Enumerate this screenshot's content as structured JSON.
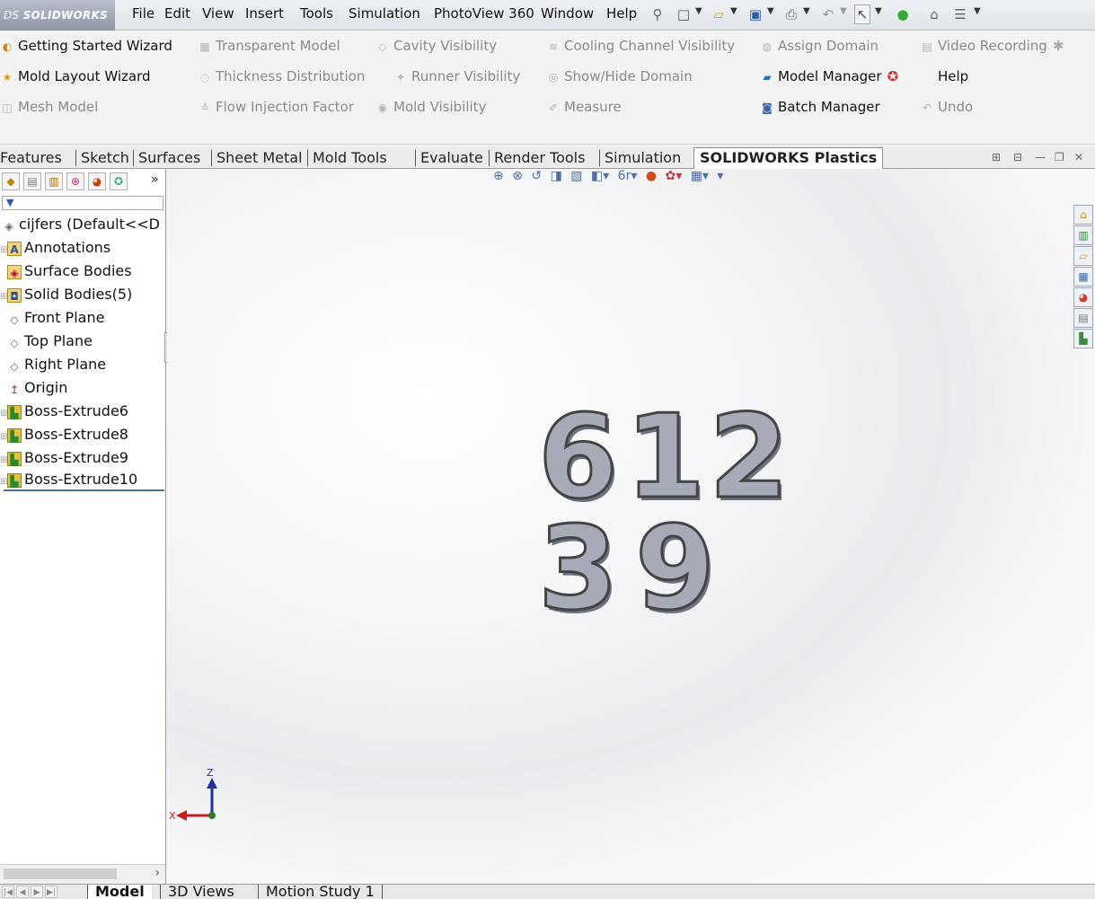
{
  "app": {
    "logo_prefix": "DS ",
    "logo_brand": "SOLIDWORKS"
  },
  "menu": {
    "items": [
      "File",
      "Edit",
      "View",
      "Insert",
      "Tools",
      "Simulation",
      "PhotoView 360",
      "Window",
      "Help"
    ]
  },
  "command_manager": {
    "row1": [
      {
        "label": "Getting Started Wizard",
        "enabled": true
      },
      {
        "label": "Transparent Model",
        "enabled": false
      },
      {
        "label": "Cavity Visibility",
        "enabled": false
      },
      {
        "label": "Cooling Channel Visibility",
        "enabled": false
      },
      {
        "label": "Assign Domain",
        "enabled": false
      },
      {
        "label": "Video Recording",
        "enabled": false
      }
    ],
    "row2": [
      {
        "label": "Mold Layout Wizard",
        "enabled": true
      },
      {
        "label": "Thickness Distribution",
        "enabled": false
      },
      {
        "label": "Runner Visibility",
        "enabled": false
      },
      {
        "label": "Show/Hide Domain",
        "enabled": false
      },
      {
        "label": "Model Manager",
        "enabled": true
      },
      {
        "label": "Help",
        "enabled": true
      }
    ],
    "row3": [
      {
        "label": "Mesh Model",
        "enabled": false
      },
      {
        "label": "Flow Injection Factor",
        "enabled": false
      },
      {
        "label": "Mold Visibility",
        "enabled": false
      },
      {
        "label": "Measure",
        "enabled": false
      },
      {
        "label": "Batch Manager",
        "enabled": true
      },
      {
        "label": "Undo",
        "enabled": false
      }
    ]
  },
  "tabs": [
    {
      "label": "Features"
    },
    {
      "label": "Sketch"
    },
    {
      "label": "Surfaces"
    },
    {
      "label": "Sheet Metal"
    },
    {
      "label": "Mold Tools"
    },
    {
      "label": "Evaluate"
    },
    {
      "label": "Render Tools"
    },
    {
      "label": "Simulation"
    },
    {
      "label": "SOLIDWORKS Plastics",
      "active": true
    }
  ],
  "feature_tree": {
    "part_name": "cijfers  (Default<<D",
    "items": [
      {
        "label": "Annotations",
        "icon": "annotations-icon"
      },
      {
        "label": "Surface Bodies",
        "icon": "surface-bodies-icon"
      },
      {
        "label": "Solid Bodies(5)",
        "icon": "solid-bodies-icon"
      },
      {
        "label": "Front Plane",
        "icon": "plane-icon"
      },
      {
        "label": "Top Plane",
        "icon": "plane-icon"
      },
      {
        "label": "Right Plane",
        "icon": "plane-icon"
      },
      {
        "label": "Origin",
        "icon": "origin-icon"
      },
      {
        "label": "Boss-Extrude6",
        "icon": "extrude-icon"
      },
      {
        "label": "Boss-Extrude8",
        "icon": "extrude-icon"
      },
      {
        "label": "Boss-Extrude9",
        "icon": "extrude-icon"
      },
      {
        "label": "Boss-Extrude10",
        "icon": "extrude-icon"
      }
    ],
    "more_glyph": "»"
  },
  "model": {
    "digits": [
      "6",
      "12",
      "3",
      "9"
    ]
  },
  "triad": {
    "x_label": "X",
    "z_label": "Z"
  },
  "bottom_tabs": [
    {
      "label": "Model",
      "active": true
    },
    {
      "label": "3D Views"
    },
    {
      "label": "Motion Study 1"
    }
  ],
  "colors": {
    "accent": "#2b5aa8",
    "model_face": "#a7aab7",
    "active_cmd_icon": "#d49a12"
  }
}
